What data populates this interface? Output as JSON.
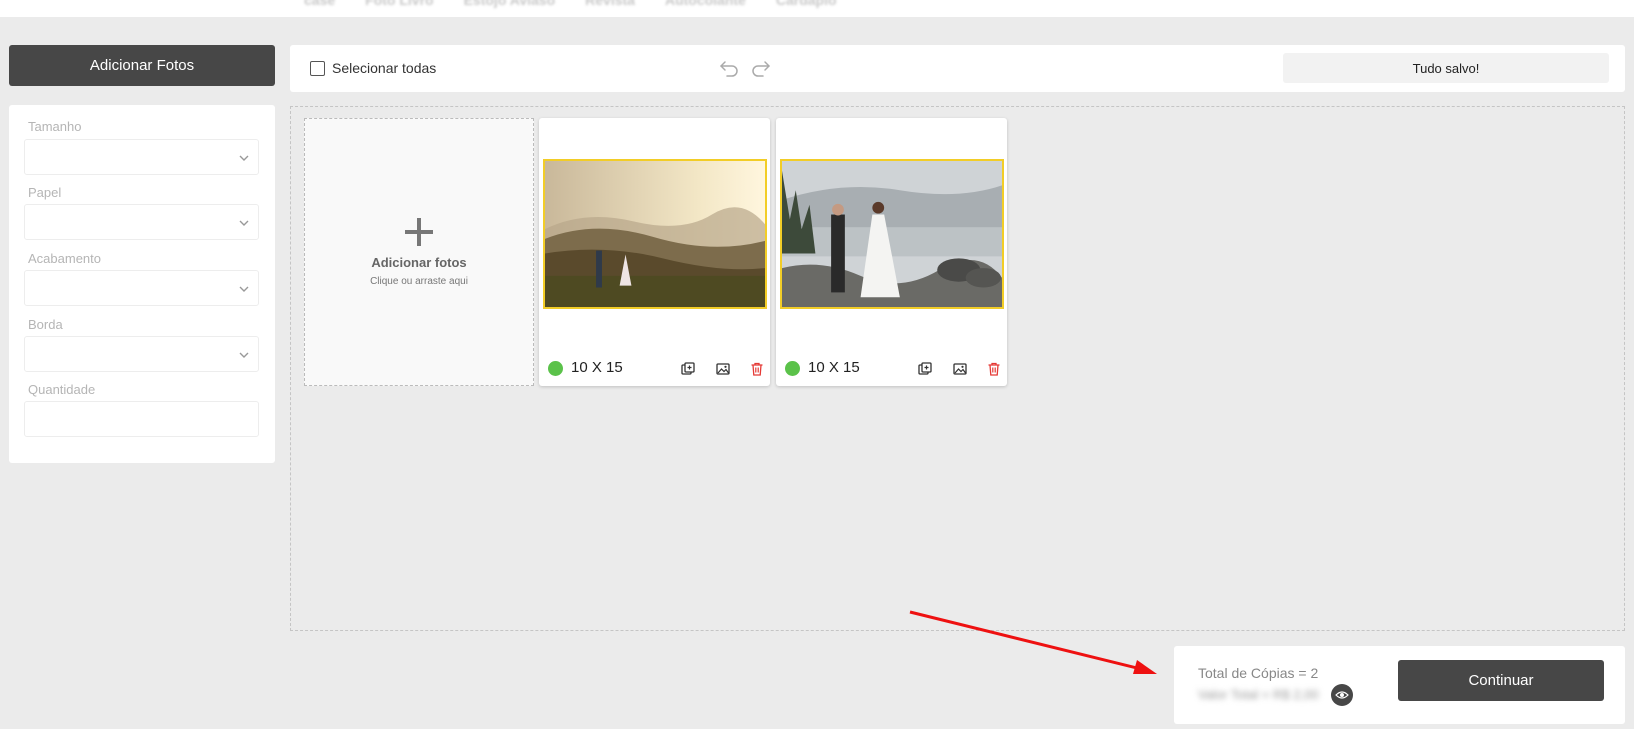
{
  "topbar": {
    "tabs": [
      "case",
      "Foto Livro",
      "Estojo Aviaso",
      "Revista",
      "Autocolante",
      "Cardápio"
    ]
  },
  "sidebar": {
    "add_photos_label": "Adicionar Fotos",
    "options": [
      {
        "label": "Tamanho",
        "value": ""
      },
      {
        "label": "Papel",
        "value": ""
      },
      {
        "label": "Acabamento",
        "value": ""
      },
      {
        "label": "Borda",
        "value": ""
      },
      {
        "label": "Quantidade",
        "value": ""
      }
    ]
  },
  "toolbar": {
    "select_all_label": "Selecionar todas",
    "status": "Tudo salvo!"
  },
  "add_card": {
    "title": "Adicionar fotos",
    "subtitle": "Clique ou arraste aqui"
  },
  "photos": [
    {
      "size": "10 X 15",
      "status_color": "#5bc24a",
      "scene": "couple-on-hill-sunset"
    },
    {
      "size": "10 X 15",
      "status_color": "#5bc24a",
      "scene": "couple-at-lake-shore"
    }
  ],
  "summary": {
    "copies_label": "Total de Cópias = 2",
    "price_label": "Valor Total = R$ 2,00",
    "continue_label": "Continuar"
  },
  "colors": {
    "primary_button": "#474747",
    "photo_border": "#f2cd27",
    "status_ok": "#5bc24a",
    "delete_icon": "#e53935",
    "annotation_arrow": "#ee1111"
  }
}
